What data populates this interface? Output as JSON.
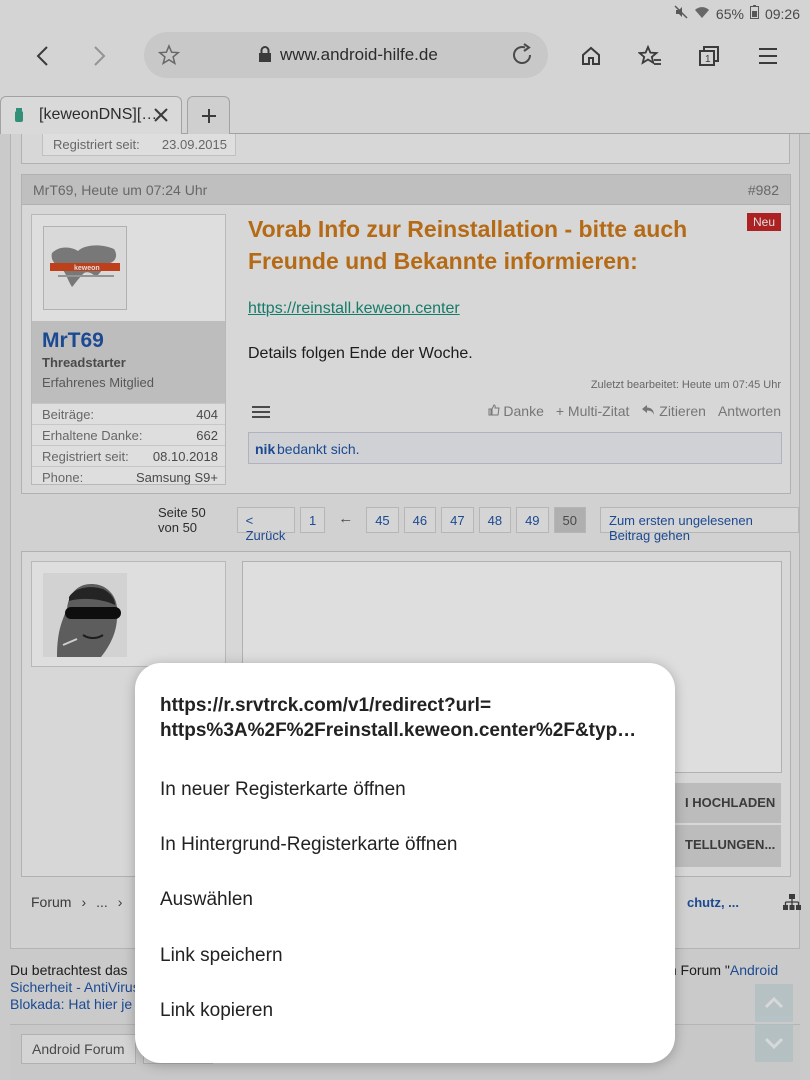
{
  "status": {
    "battery": "65%",
    "time": "09:26"
  },
  "toolbar": {
    "url": "www.android-hilfe.de"
  },
  "tab": {
    "title": "[keweonDNS][…"
  },
  "prev_post": {
    "reg_label": "Registriert seit:",
    "reg_value": "23.09.2015"
  },
  "post": {
    "header_user_time": "MrT69, Heute um 07:24 Uhr",
    "number": "#982",
    "new_badge": "Neu",
    "title": "Vorab Info zur Reinstallation - bitte auch Freunde und Bekannte informieren:",
    "link": "https://reinstall.keweon.center",
    "text": "Details folgen Ende der Woche.",
    "edited": "Zuletzt bearbeitet: Heute um 07:45 Uhr",
    "actions": [
      "Danke",
      "+ Multi-Zitat",
      "Zitieren",
      "Antworten"
    ],
    "thanks_user": "nik",
    "thanks_text": "bedankt sich."
  },
  "user": {
    "logo_text": "keweon",
    "name": "MrT69",
    "role": "Threadstarter",
    "rank": "Erfahrenes Mitglied",
    "stats": [
      {
        "label": "Beiträge:",
        "value": "404"
      },
      {
        "label": "Erhaltene Danke:",
        "value": "662"
      },
      {
        "label": "Registriert seit:",
        "value": "08.10.2018"
      },
      {
        "label": "Phone:",
        "value": "Samsung S9+"
      }
    ]
  },
  "pager": {
    "label": "Seite 50 von 50",
    "prev": "< Zurück",
    "first": "1",
    "ellipsis_arrow": "←",
    "pages": [
      "45",
      "46",
      "47",
      "48",
      "49"
    ],
    "current": "50",
    "unread": "Zum ersten ungelesenen Beitrag gehen"
  },
  "reply": {
    "upload": "I HOCHLADEN",
    "settings": "TELLUNGEN..."
  },
  "breadcrumb": {
    "items": [
      "Forum",
      "›",
      "...",
      "›"
    ],
    "right": "chutz, ..."
  },
  "footer": {
    "line1_left": "Du betrachtest das",
    "line1_right_prefix": "m Forum \"",
    "line1_right_link": "Android",
    "line2": "Sicherheit - AntiVirus",
    "line3": "Blokada: Hat hier je",
    "chip": "Android Forum"
  },
  "dialog": {
    "url_line1": "https://r.srvtrck.com/v1/redirect?url=",
    "url_line2": "https%3A%2F%2Freinstall.keweon.center%2F&typ…",
    "items": [
      "In neuer Registerkarte öffnen",
      "In Hintergrund-Registerkarte öffnen",
      "Auswählen",
      "Link speichern",
      "Link kopieren"
    ]
  }
}
